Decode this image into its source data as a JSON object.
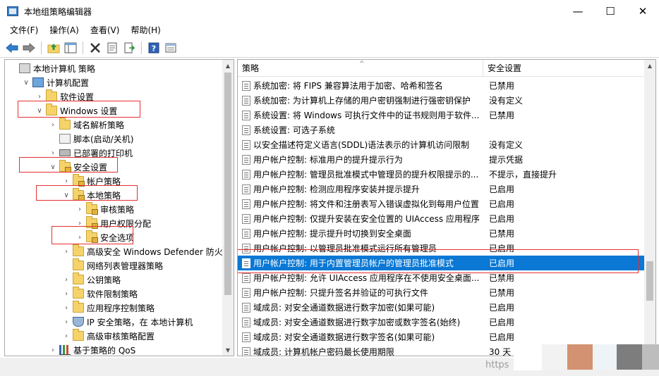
{
  "window": {
    "title": "本地组策略编辑器",
    "controls": {
      "minimize": "—",
      "maximize": "☐",
      "close": "✕"
    }
  },
  "menu": [
    "文件(F)",
    "操作(A)",
    "查看(V)",
    "帮助(H)"
  ],
  "toolbar_icons": [
    "back-arrow-icon",
    "forward-arrow-icon",
    "up-folder-icon",
    "show-hide-tree-icon",
    "delete-icon",
    "properties-icon",
    "export-list-icon",
    "help-icon",
    "view-icon"
  ],
  "tree": {
    "items": [
      {
        "label": "本地计算机 策略",
        "depth": 0,
        "expander": "",
        "icon": "policy-root-icon"
      },
      {
        "label": "计算机配置",
        "depth": 1,
        "expander": "∨",
        "icon": "computer-icon"
      },
      {
        "label": "软件设置",
        "depth": 2,
        "expander": "›",
        "icon": "folder-icon"
      },
      {
        "label": "Windows 设置",
        "depth": 2,
        "expander": "∨",
        "icon": "folder-icon"
      },
      {
        "label": "域名解析策略",
        "depth": 3,
        "expander": "›",
        "icon": "folder-icon"
      },
      {
        "label": "脚本(启动/关机)",
        "depth": 3,
        "expander": "",
        "icon": "script-icon"
      },
      {
        "label": "已部署的打印机",
        "depth": 3,
        "expander": "›",
        "icon": "printer-icon"
      },
      {
        "label": "安全设置",
        "depth": 3,
        "expander": "∨",
        "icon": "security-settings-icon"
      },
      {
        "label": "帐户策略",
        "depth": 4,
        "expander": "›",
        "icon": "locked-folder-icon"
      },
      {
        "label": "本地策略",
        "depth": 4,
        "expander": "∨",
        "icon": "locked-folder-icon"
      },
      {
        "label": "审核策略",
        "depth": 5,
        "expander": "›",
        "icon": "locked-folder-icon"
      },
      {
        "label": "用户权限分配",
        "depth": 5,
        "expander": "›",
        "icon": "locked-folder-icon"
      },
      {
        "label": "安全选项",
        "depth": 5,
        "expander": "›",
        "icon": "locked-folder-icon"
      },
      {
        "label": "高级安全 Windows Defender 防火墙",
        "depth": 4,
        "expander": "›",
        "icon": "folder-icon"
      },
      {
        "label": "网络列表管理器策略",
        "depth": 4,
        "expander": "",
        "icon": "folder-icon"
      },
      {
        "label": "公钥策略",
        "depth": 4,
        "expander": "›",
        "icon": "folder-icon"
      },
      {
        "label": "软件限制策略",
        "depth": 4,
        "expander": "›",
        "icon": "folder-icon"
      },
      {
        "label": "应用程序控制策略",
        "depth": 4,
        "expander": "›",
        "icon": "folder-icon"
      },
      {
        "label": "IP 安全策略，在 本地计算机",
        "depth": 4,
        "expander": "›",
        "icon": "ip-security-icon"
      },
      {
        "label": "高级审核策略配置",
        "depth": 4,
        "expander": "›",
        "icon": "folder-icon"
      },
      {
        "label": "基于策略的 QoS",
        "depth": 3,
        "expander": "›",
        "icon": "qos-chart-icon"
      }
    ]
  },
  "list": {
    "columns": {
      "policy": "策略",
      "setting": "安全设置"
    },
    "rows": [
      {
        "policy": "系统加密: 将 FIPS 兼容算法用于加密、哈希和签名",
        "setting": "已禁用"
      },
      {
        "policy": "系统加密: 为计算机上存储的用户密钥强制进行强密钥保护",
        "setting": "没有定义"
      },
      {
        "policy": "系统设置: 将 Windows 可执行文件中的证书规则用于软件...",
        "setting": "已禁用"
      },
      {
        "policy": "系统设置: 可选子系统",
        "setting": ""
      },
      {
        "policy": "以安全描述符定义语言(SDDL)语法表示的计算机访问限制",
        "setting": "没有定义"
      },
      {
        "policy": "用户帐户控制: 标准用户的提升提示行为",
        "setting": "提示凭据"
      },
      {
        "policy": "用户帐户控制: 管理员批准模式中管理员的提升权限提示的...",
        "setting": "不提示，直接提升"
      },
      {
        "policy": "用户帐户控制: 检测应用程序安装并提示提升",
        "setting": "已启用"
      },
      {
        "policy": "用户帐户控制: 将文件和注册表写入错误虚拟化到每用户位置",
        "setting": "已启用"
      },
      {
        "policy": "用户帐户控制: 仅提升安装在安全位置的 UIAccess 应用程序",
        "setting": "已启用"
      },
      {
        "policy": "用户帐户控制: 提示提升时切换到安全桌面",
        "setting": "已禁用"
      },
      {
        "policy": "用户帐户控制: 以管理员批准模式运行所有管理员",
        "setting": "已启用"
      },
      {
        "policy": "用户帐户控制: 用于内置管理员帐户的管理员批准模式",
        "setting": "已启用"
      },
      {
        "policy": "用户帐户控制: 允许 UIAccess 应用程序在不使用安全桌面...",
        "setting": "已禁用"
      },
      {
        "policy": "用户帐户控制: 只提升签名并验证的可执行文件",
        "setting": "已禁用"
      },
      {
        "policy": "域成员: 对安全通道数据进行数字加密(如果可能)",
        "setting": "已启用"
      },
      {
        "policy": "域成员: 对安全通道数据进行数字加密或数字签名(始终)",
        "setting": "已启用"
      },
      {
        "policy": "域成员: 对安全通道数据进行数字签名(如果可能)",
        "setting": "已启用"
      },
      {
        "policy": "域成员: 计算机帐户密码最长使用期限",
        "setting": "30 天"
      }
    ],
    "selected_index": 12
  },
  "status": {
    "watermark": "https"
  },
  "colors": {
    "selection": "#0a78d4",
    "annotation_border": "#e53030"
  }
}
